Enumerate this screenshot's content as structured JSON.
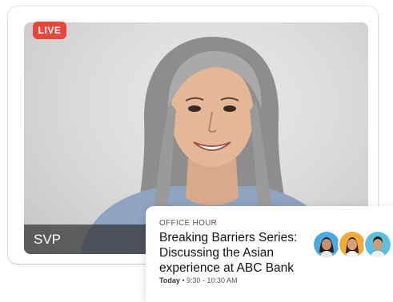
{
  "video": {
    "live_label": "LIVE",
    "live_color": "#e8453c",
    "speaker_name": "SVP"
  },
  "event": {
    "eyebrow": "OFFICE HOUR",
    "title_lines": [
      "Breaking Barriers Series:",
      "Discussing the Asian",
      "experience at ABC Bank"
    ],
    "day": "Today",
    "time": "9:30 - 10:30 AM",
    "attendees": [
      {
        "name": "attendee-1",
        "ring_color": "#4aa8e0"
      },
      {
        "name": "attendee-2",
        "ring_color": "#f2a93b"
      },
      {
        "name": "attendee-3",
        "ring_color": "#5bc0e0"
      }
    ]
  }
}
